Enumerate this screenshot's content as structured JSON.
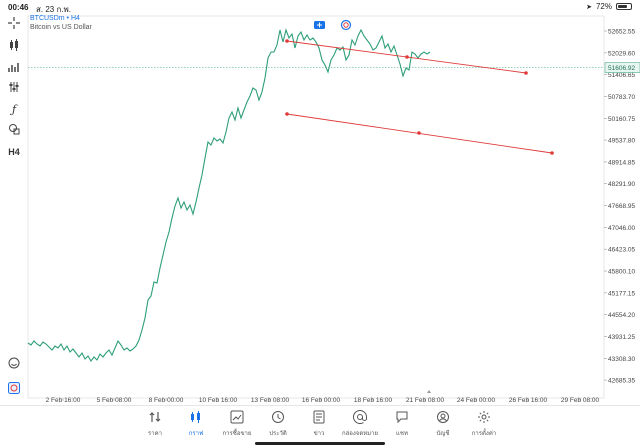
{
  "status_bar": {
    "time": "00:46",
    "date": "ส. 23 ก.พ.",
    "battery": "72%",
    "battery_level": 0.72
  },
  "symbol": {
    "name": "BTCUSDm • H4",
    "description": "Bitcoin vs US Dollar"
  },
  "toolbar_items": [
    "crosshair",
    "chart type",
    "indicators",
    "objects",
    "fibonacci",
    "shapes",
    "H4"
  ],
  "timeframe_label": "H4",
  "price_labels": [
    "52652.55",
    "52029.60",
    "51406.65",
    "50783.70",
    "50160.75",
    "49537.80",
    "48914.85",
    "48291.90",
    "47668.95",
    "47046.00",
    "46423.05",
    "45800.10",
    "45177.15",
    "44554.20",
    "43931.25",
    "43308.30",
    "42685.35"
  ],
  "current_price": "51606.92",
  "time_labels": [
    "2 Feb 16:00",
    "5 Feb 08:00",
    "8 Feb 00:00",
    "10 Feb 16:00",
    "13 Feb 08:00",
    "16 Feb 00:00",
    "18 Feb 16:00",
    "21 Feb 08:00",
    "24 Feb 00:00",
    "26 Feb 16:00",
    "29 Feb 08:00"
  ],
  "colors": {
    "price_line": "#2e9e7a",
    "trend_lines": "#e03a3a",
    "current_price_line": "#2e9e7a",
    "accent": "#1a73e8"
  },
  "bottom_nav": [
    {
      "label": "ราคา",
      "icon": "quotes-icon",
      "active": false
    },
    {
      "label": "กราฟ",
      "icon": "chart-icon",
      "active": true
    },
    {
      "label": "การซื้อขาย",
      "icon": "trade-icon",
      "active": false
    },
    {
      "label": "ประวัติ",
      "icon": "history-icon",
      "active": false
    },
    {
      "label": "ข่าว",
      "icon": "news-icon",
      "active": false
    },
    {
      "label": "กล่องจดหมาย",
      "icon": "mailbox-icon",
      "active": false
    },
    {
      "label": "แชท",
      "icon": "chat-icon",
      "active": false
    },
    {
      "label": "บัญชี",
      "icon": "account-icon",
      "active": false
    },
    {
      "label": "การตั้งค่า",
      "icon": "settings-icon",
      "active": false
    }
  ]
}
